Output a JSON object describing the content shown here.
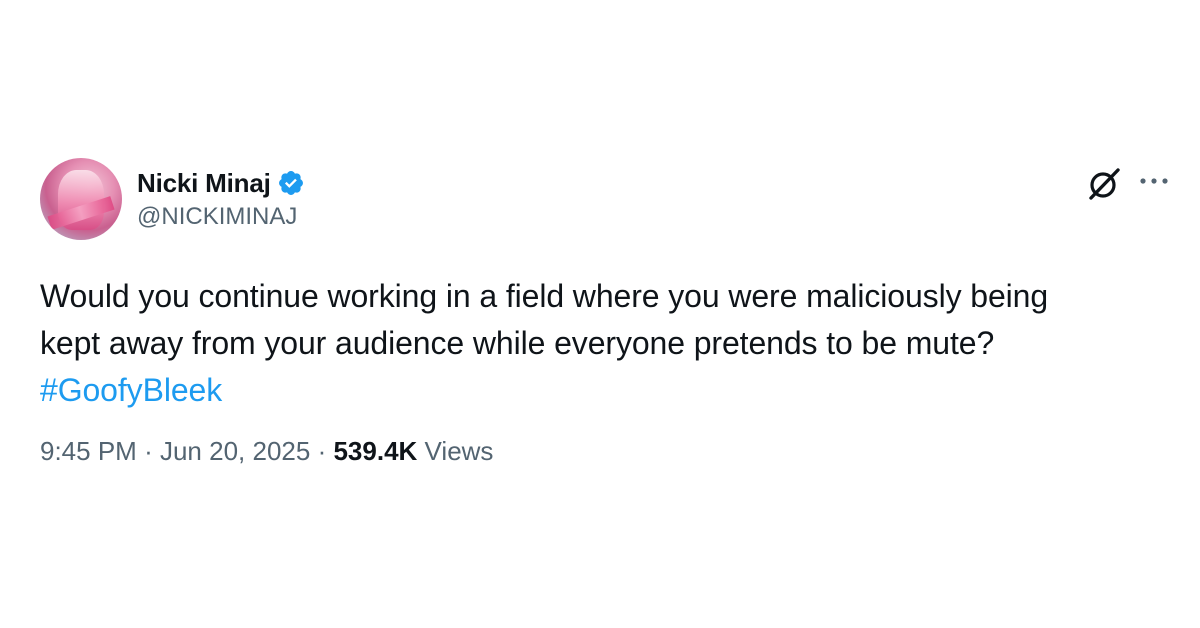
{
  "author": {
    "display_name": "Nicki Minaj",
    "handle": "@NICKIMINAJ",
    "verified": true,
    "avatar_icon": "profile-photo"
  },
  "actions": {
    "grok_icon": "grok-icon",
    "more_icon": "more-options-icon"
  },
  "tweet": {
    "line1": "Would you continue working in a field where you were maliciously being",
    "line2": "kept away from your audience while everyone pretends to be mute?",
    "hashtag": "#GoofyBleek"
  },
  "meta": {
    "time": "9:45 PM",
    "separator": "·",
    "date": "Jun 20, 2025",
    "views_count": "539.4K",
    "views_label": "Views"
  },
  "colors": {
    "text": "#0f1419",
    "secondary": "#536471",
    "link": "#1d9bf0",
    "verified": "#1d9bf0"
  }
}
